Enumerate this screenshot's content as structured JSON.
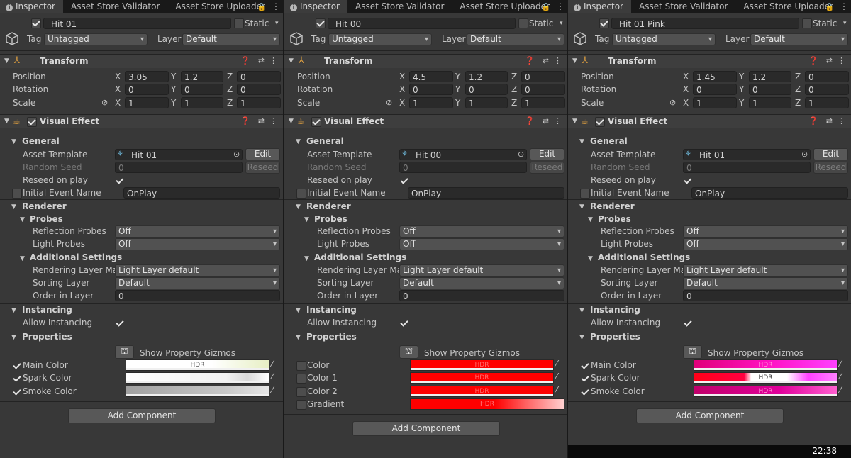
{
  "tabs": [
    "Inspector",
    "Asset Store Validator",
    "Asset Store Uploader"
  ],
  "tab_icons": [
    "info-icon",
    "lock-icon",
    "more-icon"
  ],
  "labels": {
    "static": "Static",
    "tag": "Tag",
    "layer": "Layer",
    "transform": "Transform",
    "position": "Position",
    "rotation": "Rotation",
    "scale": "Scale",
    "x": "X",
    "y": "Y",
    "z": "Z",
    "visual_effect": "Visual Effect",
    "general": "General",
    "asset_template": "Asset Template",
    "edit": "Edit",
    "random_seed": "Random Seed",
    "reseed": "Reseed",
    "reseed_on_play": "Reseed on play",
    "initial_event_name": "Initial Event Name",
    "renderer": "Renderer",
    "probes": "Probes",
    "reflection_probes": "Reflection Probes",
    "light_probes": "Light Probes",
    "additional_settings": "Additional Settings",
    "rendering_layer_mask": "Rendering Layer Mas",
    "sorting_layer": "Sorting Layer",
    "order_in_layer": "Order in Layer",
    "instancing": "Instancing",
    "allow_instancing": "Allow Instancing",
    "properties": "Properties",
    "show_property_gizmos": "Show Property Gizmos",
    "hdr": "HDR",
    "add_component": "Add Component"
  },
  "panels": [
    {
      "name": "_Hit 01",
      "tag": "Untagged",
      "layer": "Default",
      "position": [
        "3.05",
        "1.2",
        "0"
      ],
      "rotation": [
        "0",
        "0",
        "0"
      ],
      "scale": [
        "1",
        "1",
        "1"
      ],
      "asset_template": "_Hit 01",
      "random_seed": "0",
      "initial_event": "OnPlay",
      "reflection_probes": "Off",
      "light_probes": "Off",
      "rendering_layer": "Light Layer default",
      "sorting_layer": "Default",
      "order_in_layer": "0",
      "properties": [
        {
          "label": "Main Color",
          "checked": true,
          "bg": "linear-gradient(90deg,#ffffff 0%,#ffffff 60%,#e7efc4 100%)",
          "hdr": true,
          "hdr_color": "#5a5a5a"
        },
        {
          "label": "Spark Color",
          "checked": true,
          "bg": "linear-gradient(90deg,#ffffff 0%,#f2f2f2 70%,#d8d8d8 85%,#ffffff 100%)",
          "hdr": false
        },
        {
          "label": "Smoke Color",
          "checked": true,
          "bg": "linear-gradient(90deg,#a0a0a0 0%,#c8c8c8 70%,#e6e6e6 100%)",
          "hdr": false
        }
      ]
    },
    {
      "name": "_Hit 00",
      "tag": "Untagged",
      "layer": "Default",
      "position": [
        "4.5",
        "1.2",
        "0"
      ],
      "rotation": [
        "0",
        "0",
        "0"
      ],
      "scale": [
        "1",
        "1",
        "1"
      ],
      "asset_template": "_Hit 00",
      "random_seed": "0",
      "initial_event": "OnPlay",
      "reflection_probes": "Off",
      "light_probes": "Off",
      "rendering_layer": "Light Layer default",
      "sorting_layer": "Default",
      "order_in_layer": "0",
      "properties": [
        {
          "label": "Color",
          "checked": false,
          "bg": "#ff0000",
          "hdr": true,
          "hdr_color": "#ff6a6a"
        },
        {
          "label": "Color 1",
          "checked": false,
          "bg": "#ff0000",
          "hdr": true,
          "hdr_color": "#ff6a6a"
        },
        {
          "label": "Color 2",
          "checked": false,
          "bg": "#ff0000",
          "hdr": true,
          "hdr_color": "#ff6a6a"
        },
        {
          "label": "Gradient",
          "checked": false,
          "bg": "linear-gradient(90deg,#ff0000 0%,#ff0000 55%,#ff6060 75%,#ffd0d0 100%)",
          "hdr": true,
          "hdr_color": "#ff7a7a"
        }
      ]
    },
    {
      "name": "_Hit 01 Pink",
      "tag": "Untagged",
      "layer": "Default",
      "position": [
        "1.45",
        "1.2",
        "0"
      ],
      "rotation": [
        "0",
        "0",
        "0"
      ],
      "scale": [
        "1",
        "1",
        "1"
      ],
      "asset_template": "_Hit 01",
      "random_seed": "0",
      "initial_event": "OnPlay",
      "reflection_probes": "Off",
      "light_probes": "Off",
      "rendering_layer": "Light Layer default",
      "sorting_layer": "Default",
      "order_in_layer": "0",
      "properties": [
        {
          "label": "Main Color",
          "checked": true,
          "bg": "linear-gradient(90deg,#e0007a 0%,#ff10c0 50%,#ff40ff 100%)",
          "hdr": true,
          "hdr_color": "#ff9ad8"
        },
        {
          "label": "Spark Color",
          "checked": true,
          "bg": "linear-gradient(90deg,#ff0018 0%,#ff0040 35%,#ffffff 40%,#ffffff 65%,#ff40ff 80%,#ff80ff 100%)",
          "hdr": true,
          "hdr_color": "#303030"
        },
        {
          "label": "Smoke Color",
          "checked": true,
          "bg": "linear-gradient(90deg,#c0006a 0%,#e0009a 60%,#ff60d0 100%)",
          "hdr": true,
          "hdr_color": "#ff9ad8"
        }
      ]
    }
  ],
  "clock": "22:38"
}
